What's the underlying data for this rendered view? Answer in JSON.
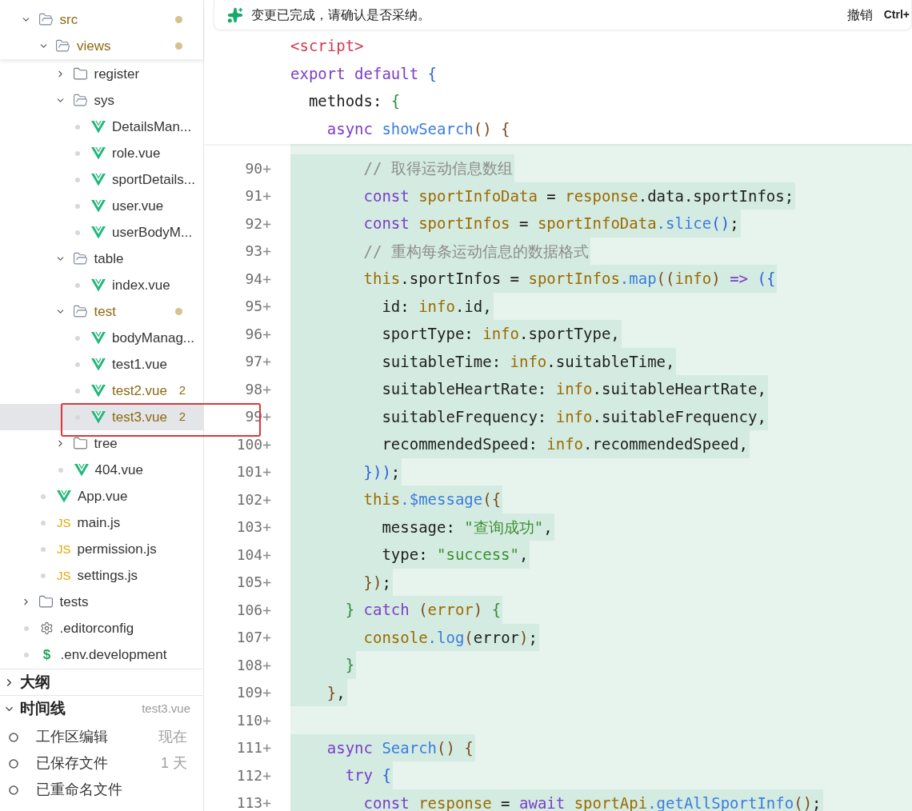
{
  "explorer": {
    "sticky": [
      {
        "name": "src",
        "kind": "folder",
        "expanded": true,
        "modified": true
      },
      {
        "name": "views",
        "kind": "folder",
        "expanded": true,
        "modified": true
      }
    ],
    "tree": [
      {
        "name": "register",
        "kind": "folder",
        "expanded": false,
        "modified": false
      },
      {
        "name": "sys",
        "kind": "folder",
        "expanded": true,
        "modified": false,
        "children": [
          {
            "name": "DetailsMan...",
            "kind": "vue",
            "modified": false,
            "selected": false
          },
          {
            "name": "role.vue",
            "kind": "vue",
            "modified": false,
            "selected": false
          },
          {
            "name": "sportDetails...",
            "kind": "vue",
            "modified": false,
            "selected": false
          },
          {
            "name": "user.vue",
            "kind": "vue",
            "modified": false,
            "selected": false
          },
          {
            "name": "userBodyM...",
            "kind": "vue",
            "modified": false,
            "selected": false
          }
        ]
      },
      {
        "name": "table",
        "kind": "folder",
        "expanded": true,
        "modified": false,
        "children": [
          {
            "name": "index.vue",
            "kind": "vue",
            "modified": false,
            "selected": false
          }
        ]
      },
      {
        "name": "test",
        "kind": "folder",
        "expanded": true,
        "modified": true,
        "children": [
          {
            "name": "bodyManag...",
            "kind": "vue",
            "modified": false,
            "selected": false
          },
          {
            "name": "test1.vue",
            "kind": "vue",
            "modified": false,
            "selected": false
          },
          {
            "name": "test2.vue",
            "kind": "vue",
            "modified": true,
            "badge": "2",
            "selected": false
          },
          {
            "name": "test3.vue",
            "kind": "vue",
            "modified": true,
            "badge": "2",
            "selected": true,
            "annotated": true
          }
        ]
      },
      {
        "name": "tree",
        "kind": "folder",
        "expanded": false,
        "modified": false
      },
      {
        "name": "404.vue",
        "kind": "vue",
        "modified": false,
        "selected": false
      }
    ],
    "after_views": [
      {
        "name": "App.vue",
        "kind": "vue",
        "modified": false,
        "selected": false
      },
      {
        "name": "main.js",
        "kind": "js",
        "icon_text": "JS",
        "modified": false,
        "selected": false
      },
      {
        "name": "permission.js",
        "kind": "js",
        "icon_text": "JS",
        "modified": false,
        "selected": false
      },
      {
        "name": "settings.js",
        "kind": "js",
        "icon_text": "JS",
        "modified": false,
        "selected": false
      }
    ],
    "root_items": [
      {
        "name": "tests",
        "kind": "folder",
        "expanded": false,
        "modified": false
      },
      {
        "name": ".editorconfig",
        "kind": "config",
        "modified": false,
        "selected": false
      },
      {
        "name": ".env.development",
        "kind": "env",
        "icon_text": "$",
        "modified": false,
        "selected": false
      }
    ]
  },
  "outline": {
    "title": "大纲",
    "expanded": false
  },
  "timeline": {
    "title": "时间线",
    "expanded": true,
    "file": "test3.vue",
    "entries": [
      {
        "label": "工作区编辑",
        "time": "现在"
      },
      {
        "label": "已保存文件",
        "time": "1 天"
      },
      {
        "label": "已重命名文件"
      }
    ]
  },
  "notice": {
    "text": "变更已完成，请确认是否采纳。",
    "undo": "撤销",
    "shortcut": "Ctrl+"
  },
  "sticky_lines": [
    [
      {
        "kind": "tag",
        "text": "<script>"
      }
    ],
    [
      {
        "kind": "kw",
        "text": "export default"
      },
      {
        "kind": "b1",
        "text": " {"
      }
    ],
    [
      {
        "kind": "p",
        "text": "  methods: "
      },
      {
        "kind": "b2",
        "text": "{"
      }
    ],
    [
      {
        "kind": "kw",
        "text": "    async"
      },
      {
        "kind": "fn",
        "text": " showSearch"
      },
      {
        "kind": "b3",
        "text": "() {"
      }
    ]
  ],
  "lines": [
    {
      "number": "90",
      "marker": "+",
      "added": true,
      "tokens": [
        {
          "kind": "cm",
          "text": "        // 取得运动信息数组"
        }
      ]
    },
    {
      "number": "91",
      "marker": "+",
      "added": true,
      "tokens": [
        {
          "kind": "kw",
          "text": "        const"
        },
        {
          "kind": "var",
          "text": " sportInfoData"
        },
        {
          "kind": "p",
          "text": " = "
        },
        {
          "kind": "var",
          "text": "response"
        },
        {
          "kind": "p",
          "text": ".data.sportInfos;"
        }
      ]
    },
    {
      "number": "92",
      "marker": "+",
      "added": true,
      "tokens": [
        {
          "kind": "kw",
          "text": "        const"
        },
        {
          "kind": "var",
          "text": " sportInfos"
        },
        {
          "kind": "p",
          "text": " = "
        },
        {
          "kind": "var",
          "text": "sportInfoData"
        },
        {
          "kind": "fn",
          "text": ".slice"
        },
        {
          "kind": "b1",
          "text": "()"
        },
        {
          "kind": "p",
          "text": ";"
        }
      ]
    },
    {
      "number": "93",
      "marker": "+",
      "added": true,
      "tokens": [
        {
          "kind": "cm",
          "text": "        // 重构每条运动信息的数据格式"
        }
      ]
    },
    {
      "number": "94",
      "marker": "+",
      "added": true,
      "tokens": [
        {
          "kind": "var",
          "text": "        this"
        },
        {
          "kind": "p",
          "text": ".sportInfos = "
        },
        {
          "kind": "var",
          "text": "sportInfos"
        },
        {
          "kind": "fn",
          "text": ".map"
        },
        {
          "kind": "b3",
          "text": "(("
        },
        {
          "kind": "var",
          "text": "info"
        },
        {
          "kind": "b3",
          "text": ")"
        },
        {
          "kind": "kw",
          "text": " =>"
        },
        {
          "kind": "b1",
          "text": " ({"
        }
      ]
    },
    {
      "number": "95",
      "marker": "+",
      "added": true,
      "tokens": [
        {
          "kind": "p",
          "text": "          id: "
        },
        {
          "kind": "var",
          "text": "info"
        },
        {
          "kind": "p",
          "text": ".id,"
        }
      ]
    },
    {
      "number": "96",
      "marker": "+",
      "added": true,
      "tokens": [
        {
          "kind": "p",
          "text": "          sportType: "
        },
        {
          "kind": "var",
          "text": "info"
        },
        {
          "kind": "p",
          "text": ".sportType,"
        }
      ]
    },
    {
      "number": "97",
      "marker": "+",
      "added": true,
      "tokens": [
        {
          "kind": "p",
          "text": "          suitableTime: "
        },
        {
          "kind": "var",
          "text": "info"
        },
        {
          "kind": "p",
          "text": ".suitableTime,"
        }
      ]
    },
    {
      "number": "98",
      "marker": "+",
      "added": true,
      "tokens": [
        {
          "kind": "p",
          "text": "          suitableHeartRate: "
        },
        {
          "kind": "var",
          "text": "info"
        },
        {
          "kind": "p",
          "text": ".suitableHeartRate,"
        }
      ]
    },
    {
      "number": "99",
      "marker": "+",
      "added": true,
      "tokens": [
        {
          "kind": "p",
          "text": "          suitableFrequency: "
        },
        {
          "kind": "var",
          "text": "info"
        },
        {
          "kind": "p",
          "text": ".suitableFrequency,"
        }
      ]
    },
    {
      "number": "100",
      "marker": "+",
      "added": true,
      "tokens": [
        {
          "kind": "p",
          "text": "          recommendedSpeed: "
        },
        {
          "kind": "var",
          "text": "info"
        },
        {
          "kind": "p",
          "text": ".recommendedSpeed,"
        }
      ]
    },
    {
      "number": "101",
      "marker": "+",
      "added": true,
      "tokens": [
        {
          "kind": "b1",
          "text": "        }))"
        },
        {
          "kind": "p",
          "text": ";"
        }
      ]
    },
    {
      "number": "102",
      "marker": "+",
      "added": true,
      "tokens": [
        {
          "kind": "var",
          "text": "        this"
        },
        {
          "kind": "fn",
          "text": ".$message"
        },
        {
          "kind": "b3",
          "text": "({"
        }
      ]
    },
    {
      "number": "103",
      "marker": "+",
      "added": true,
      "tokens": [
        {
          "kind": "p",
          "text": "          message: "
        },
        {
          "kind": "str",
          "text": "\"查询成功\""
        },
        {
          "kind": "p",
          "text": ","
        }
      ]
    },
    {
      "number": "104",
      "marker": "+",
      "added": true,
      "tokens": [
        {
          "kind": "p",
          "text": "          type: "
        },
        {
          "kind": "str",
          "text": "\"success\""
        },
        {
          "kind": "p",
          "text": ","
        }
      ]
    },
    {
      "number": "105",
      "marker": "+",
      "added": true,
      "tokens": [
        {
          "kind": "b3",
          "text": "        })"
        },
        {
          "kind": "p",
          "text": ";"
        }
      ]
    },
    {
      "number": "106",
      "marker": "+",
      "added": true,
      "tokens": [
        {
          "kind": "b2",
          "text": "      }"
        },
        {
          "kind": "kw",
          "text": " catch"
        },
        {
          "kind": "b3",
          "text": " ("
        },
        {
          "kind": "var",
          "text": "error"
        },
        {
          "kind": "b3",
          "text": ")"
        },
        {
          "kind": "b2",
          "text": " {"
        }
      ]
    },
    {
      "number": "107",
      "marker": "+",
      "added": true,
      "tokens": [
        {
          "kind": "var",
          "text": "        console"
        },
        {
          "kind": "fn",
          "text": ".log"
        },
        {
          "kind": "b3",
          "text": "("
        },
        {
          "kind": "p",
          "text": "error"
        },
        {
          "kind": "b3",
          "text": ")"
        },
        {
          "kind": "p",
          "text": ";"
        }
      ]
    },
    {
      "number": "108",
      "marker": "+",
      "added": true,
      "tokens": [
        {
          "kind": "b2",
          "text": "      }"
        }
      ]
    },
    {
      "number": "109",
      "marker": "+",
      "added": true,
      "tokens": [
        {
          "kind": "b3",
          "text": "    }"
        },
        {
          "kind": "p",
          "text": ","
        }
      ]
    },
    {
      "number": "110",
      "marker": "+",
      "added": true
    },
    {
      "number": "111",
      "marker": "+",
      "added": true,
      "tokens": [
        {
          "kind": "kw",
          "text": "    async"
        },
        {
          "kind": "fn",
          "text": " Search"
        },
        {
          "kind": "b3",
          "text": "() {"
        }
      ]
    },
    {
      "number": "112",
      "marker": "+",
      "added": true,
      "tokens": [
        {
          "kind": "kw",
          "text": "      try"
        },
        {
          "kind": "b1",
          "text": " {"
        }
      ]
    },
    {
      "number": "113",
      "marker": "+",
      "added": true,
      "tokens": [
        {
          "kind": "kw",
          "text": "        const"
        },
        {
          "kind": "var",
          "text": " response"
        },
        {
          "kind": "p",
          "text": " = "
        },
        {
          "kind": "kw",
          "text": "await"
        },
        {
          "kind": "var",
          "text": " sportApi"
        },
        {
          "kind": "fn",
          "text": ".getAllSportInfo"
        },
        {
          "kind": "b3",
          "text": "()"
        },
        {
          "kind": "p",
          "text": ";"
        }
      ]
    }
  ]
}
